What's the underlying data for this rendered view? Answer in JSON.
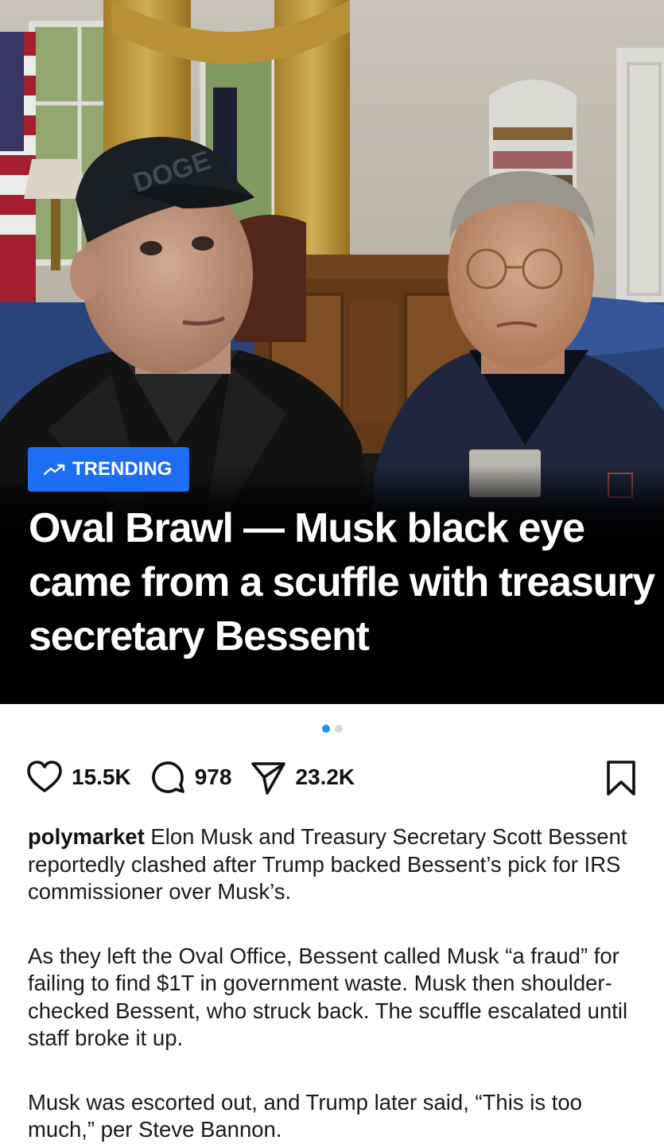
{
  "post": {
    "badge": {
      "icon": "trending-up-icon",
      "label": "TRENDING",
      "color": "#1d6ef5"
    },
    "headline": "Oval Brawl — Musk black eye came from a scuffle with treasury secretary Bessent",
    "image_description_hidden": "",
    "carousel": {
      "count": 2,
      "active": 1
    }
  },
  "actions": {
    "like": {
      "icon": "heart-icon",
      "count": "15.5K"
    },
    "comment": {
      "icon": "comment-bubble-icon",
      "count": "978"
    },
    "share": {
      "icon": "send-icon",
      "count": "23.2K"
    },
    "save": {
      "icon": "bookmark-icon"
    }
  },
  "caption": {
    "username": "polymarket",
    "paragraph1": "Elon Musk and Treasury Secretary Scott Bessent reportedly clashed after Trump backed Bessent’s pick for IRS commissioner over Musk’s.",
    "paragraph2": "As they left the Oval Office, Bessent called Musk “a fraud” for failing to find $1T in government waste. Musk then shoulder-checked Bessent, who struck back. The scuffle escalated until staff broke it up.",
    "paragraph3": "Musk was escorted out, and Trump later said, “This is too much,” per Steve Bannon."
  },
  "photo_text": {
    "cap_text": "DOGE"
  },
  "colors": {
    "accent": "#1d6ef5",
    "dot_active": "#1d8ef5"
  }
}
